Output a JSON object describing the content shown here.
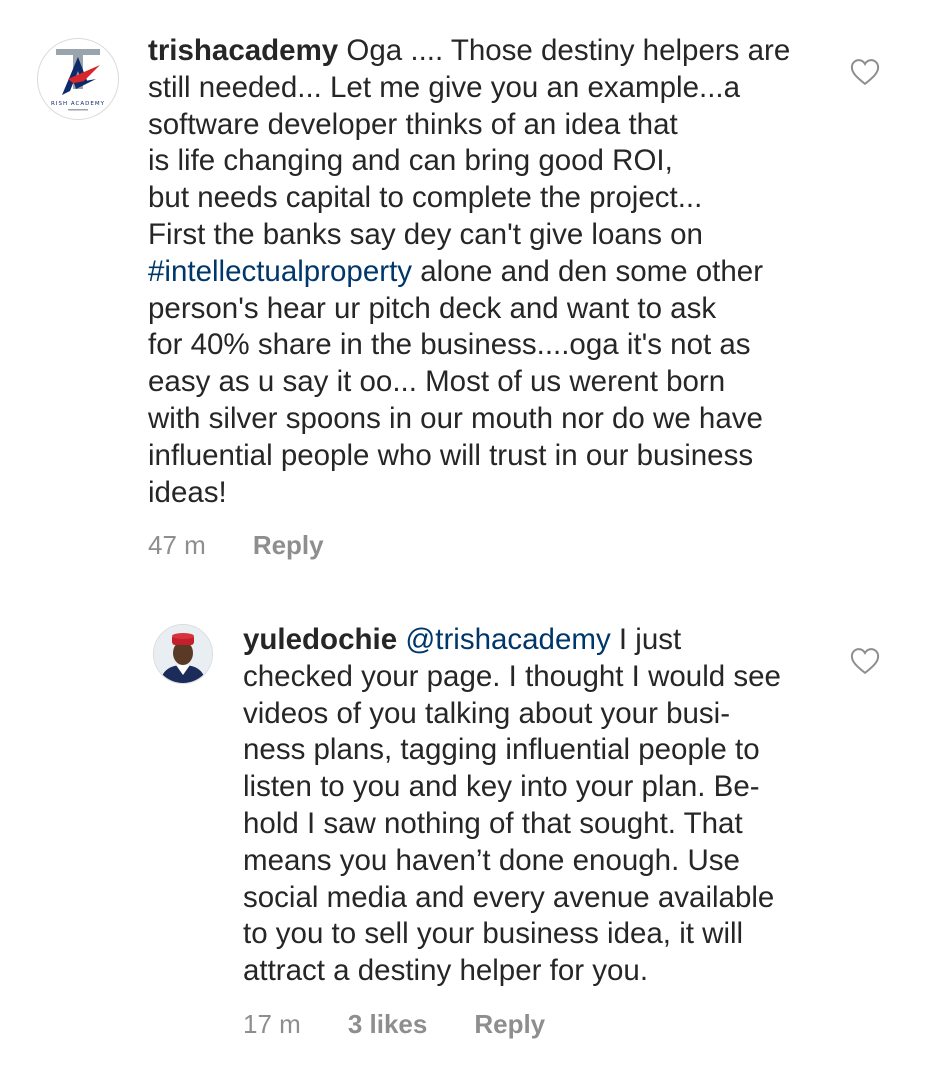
{
  "comments": [
    {
      "username": "trishacademy",
      "text_lead": "Oga .... Those destiny helpers are",
      "text_lines": [
        "still needed... Let me give you an example...a",
        "software developer thinks of an idea that",
        "is life changing and can bring good ROI,",
        "but needs capital to complete the project...",
        "First the banks say dey can't give loans on"
      ],
      "hashtag": "#intellectualproperty",
      "text_after_hashtag": "alone and den some other",
      "text_tail": [
        "person's hear ur pitch deck and want to ask",
        "for 40% share in the business....oga it's not as",
        "easy as u say it oo... Most of us werent born",
        "with silver spoons in our mouth nor do we have",
        "influential people who will trust in our business",
        "ideas!"
      ],
      "time": "47 m",
      "reply_label": "Reply",
      "avatar_icon": "academy-logo-icon",
      "avatar_text": "RISH ACADEMY"
    },
    {
      "username": "yuledochie",
      "mention": "@trishacademy",
      "text_lead": "I just",
      "text_lines": [
        "checked your page. I thought I would see",
        "videos of you talking about your busi-",
        "ness plans, tagging influential people to",
        "listen to you and key into your plan. Be-",
        "hold I saw nothing of that sought. That",
        "means you haven’t done enough. Use",
        "social media and every avenue available",
        "to you to sell your business idea, it will",
        "attract a destiny helper for you."
      ],
      "time": "17 m",
      "likes": "3 likes",
      "reply_label": "Reply",
      "avatar_icon": "profile-photo-icon"
    }
  ],
  "colors": {
    "text": "#262626",
    "link": "#00376b",
    "meta": "#8e8e8e"
  }
}
